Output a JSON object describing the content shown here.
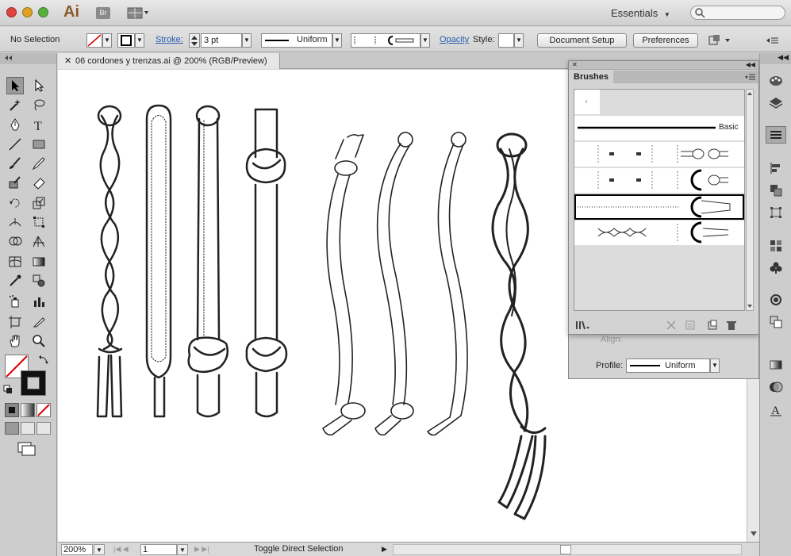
{
  "titlebar": {
    "app_logo": "Ai",
    "bridge_label": "Br",
    "workspace": "Essentials",
    "search_placeholder": ""
  },
  "control_bar": {
    "selection": "No Selection",
    "stroke_label": "Stroke:",
    "stroke_weight": "3 pt",
    "profile": "Uniform",
    "opacity_label": "Opacity",
    "style_label": "Style:",
    "document_setup": "Document Setup",
    "preferences": "Preferences"
  },
  "document": {
    "tab_title": "06 cordones y trenzas.ai @ 200% (RGB/Preview)",
    "zoom": "200%",
    "artboard": "1",
    "status_text": "Toggle Direct Selection"
  },
  "brushes_panel": {
    "title": "Brushes",
    "basic_label": "Basic"
  },
  "stroke_panel": {
    "align_label": "Align:",
    "profile_label": "Profile:",
    "profile_value": "Uniform"
  },
  "icons": {
    "selection": "selection-arrow-icon",
    "direct_selection": "direct-selection-icon",
    "magic_wand": "magic-wand-icon",
    "lasso": "lasso-icon",
    "pen": "pen-icon",
    "type": "type-icon",
    "line": "line-segment-icon",
    "rectangle": "rectangle-icon",
    "paintbrush": "paintbrush-icon",
    "pencil": "pencil-icon",
    "blob_brush": "blob-brush-icon",
    "eraser": "eraser-icon",
    "rotate": "rotate-icon",
    "scale": "scale-icon",
    "hand": "hand-icon",
    "zoom": "zoom-icon"
  },
  "colors": {
    "chrome": "#d6d6d6",
    "link": "#2a5db0",
    "close": "#e0443e",
    "minimize": "#dea123",
    "maximize": "#58b13f",
    "ai_brand": "#8a5a2b"
  }
}
